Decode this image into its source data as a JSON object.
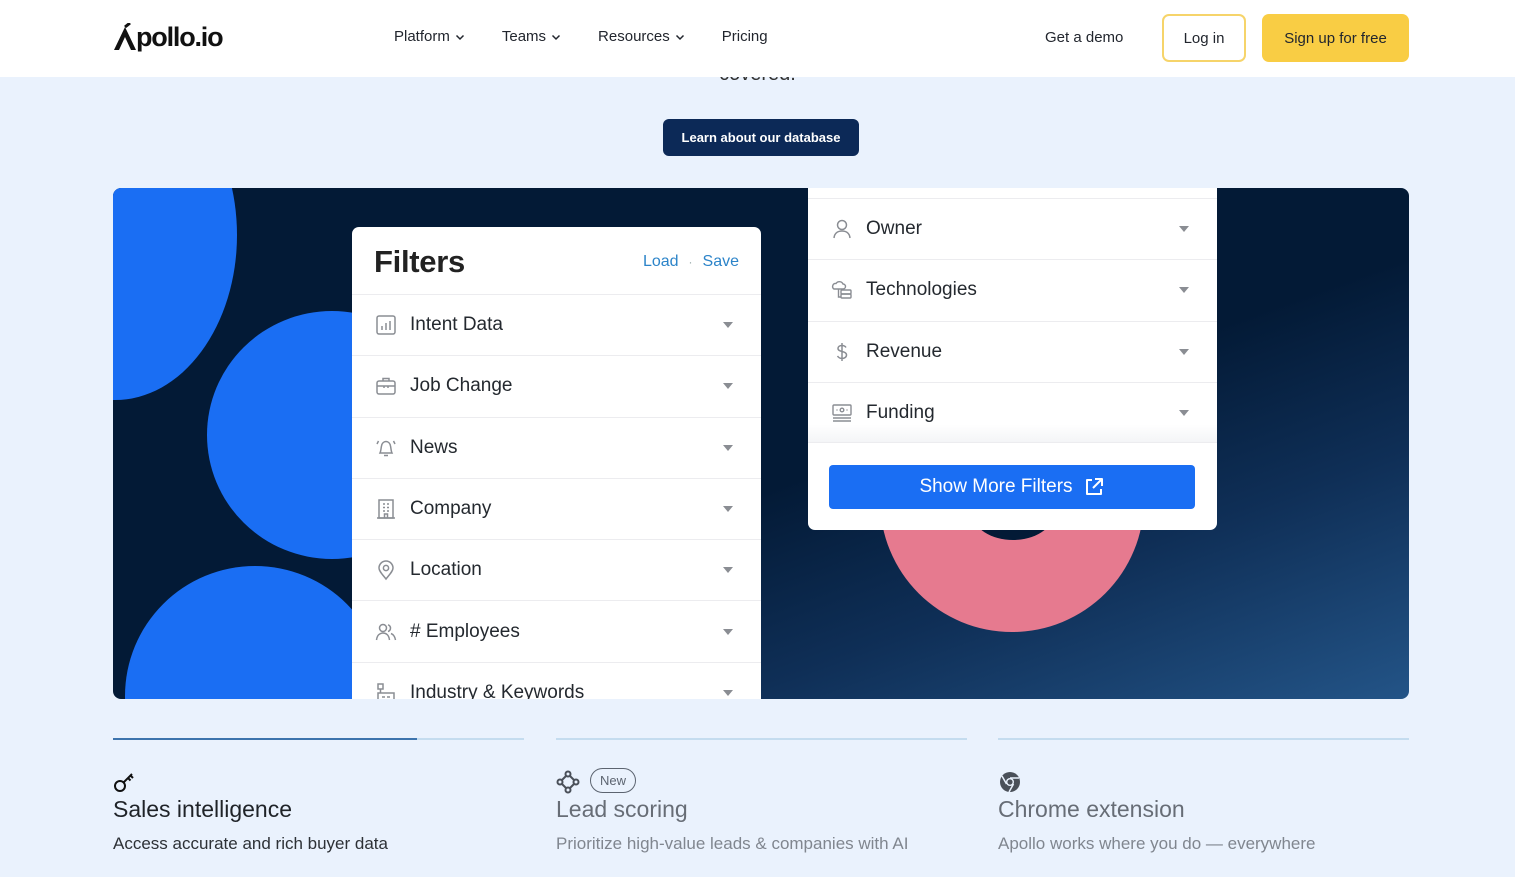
{
  "header": {
    "logo": "Apollo.io",
    "nav": [
      {
        "label": "Platform",
        "has_dropdown": true
      },
      {
        "label": "Teams",
        "has_dropdown": true
      },
      {
        "label": "Resources",
        "has_dropdown": true
      },
      {
        "label": "Pricing",
        "has_dropdown": false
      }
    ],
    "get_demo": "Get a demo",
    "login": "Log in",
    "signup": "Sign up for free"
  },
  "hero": {
    "covered_text": "covered.",
    "cta": "Learn about our database"
  },
  "filters_card": {
    "title": "Filters",
    "load": "Load",
    "separator": "·",
    "save": "Save",
    "items": [
      {
        "label": "Intent Data",
        "icon": "bar-chart-icon"
      },
      {
        "label": "Job Change",
        "icon": "briefcase-icon"
      },
      {
        "label": "News",
        "icon": "bell-icon"
      },
      {
        "label": "Company",
        "icon": "building-icon"
      },
      {
        "label": "Location",
        "icon": "map-pin-icon"
      },
      {
        "label": "# Employees",
        "icon": "users-icon"
      },
      {
        "label": "Industry & Keywords",
        "icon": "industry-icon"
      }
    ]
  },
  "right_card": {
    "items": [
      {
        "label": "Owner",
        "icon": "user-icon"
      },
      {
        "label": "Technologies",
        "icon": "cloud-server-icon"
      },
      {
        "label": "Revenue",
        "icon": "dollar-icon"
      },
      {
        "label": "Funding",
        "icon": "money-icon"
      }
    ],
    "show_more": "Show More Filters"
  },
  "features": [
    {
      "title": "Sales intelligence",
      "desc": "Access accurate and rich buyer data",
      "icon": "key-icon",
      "active": true,
      "progress": 0.74
    },
    {
      "title": "Lead scoring",
      "desc": "Prioritize high-value leads & companies with AI",
      "icon": "nodes-icon",
      "badge": "New",
      "active": false,
      "progress": 0
    },
    {
      "title": "Chrome extension",
      "desc": "Apollo works where you do — everywhere",
      "icon": "chrome-icon",
      "active": false,
      "progress": 0
    }
  ],
  "colors": {
    "brand_yellow": "#f9cd44",
    "navy": "#0c2957",
    "blue": "#1a6ef3",
    "pink": "#e67a8f",
    "link": "#2c84c9"
  }
}
